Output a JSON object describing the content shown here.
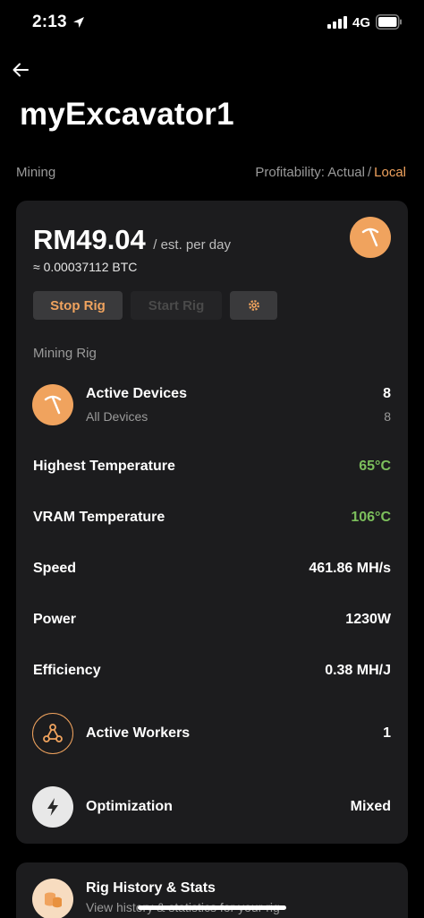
{
  "status": {
    "time": "2:13",
    "network": "4G"
  },
  "header": {
    "title": "myExcavator1"
  },
  "section": {
    "label": "Mining",
    "profitability_prefix": "Profitability:",
    "profitability_actual": "Actual",
    "profitability_separator": "/",
    "profitability_local": "Local"
  },
  "earnings": {
    "value": "RM49.04",
    "unit": "/ est. per day",
    "btc": "≈ 0.00037112 BTC"
  },
  "actions": {
    "stop": "Stop Rig",
    "start": "Start Rig",
    "settings_icon": "gear-icon"
  },
  "rig": {
    "label": "Mining Rig",
    "active_devices": {
      "label": "Active Devices",
      "value": "8",
      "sub_label": "All Devices",
      "sub_value": "8"
    },
    "highest_temp": {
      "label": "Highest Temperature",
      "value": "65°C"
    },
    "vram_temp": {
      "label": "VRAM Temperature",
      "value": "106°C"
    },
    "speed": {
      "label": "Speed",
      "value": "461.86 MH/s"
    },
    "power": {
      "label": "Power",
      "value": "1230W"
    },
    "efficiency": {
      "label": "Efficiency",
      "value": "0.38 MH/J"
    },
    "active_workers": {
      "label": "Active Workers",
      "value": "1"
    },
    "optimization": {
      "label": "Optimization",
      "value": "Mixed"
    }
  },
  "history": {
    "title": "Rig History & Stats",
    "subtitle": "View history & statistics for your rig"
  },
  "colors": {
    "accent": "#f0a35e",
    "good": "#7cbf5c",
    "card": "#1c1c1e",
    "background": "#000000"
  }
}
